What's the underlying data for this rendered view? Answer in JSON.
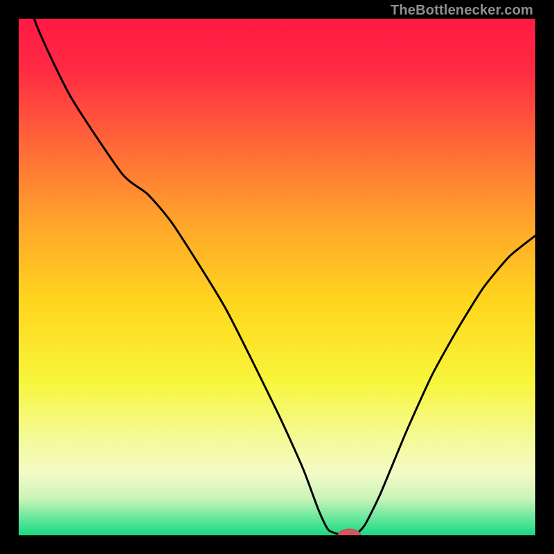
{
  "attribution": "TheBottlenecker.com",
  "colors": {
    "frame": "#000000",
    "curve": "#000000",
    "marker_fill": "#d7565e",
    "marker_stroke": "#b84a52"
  },
  "chart_data": {
    "type": "line",
    "title": "",
    "xlabel": "",
    "ylabel": "",
    "xlim": [
      0,
      100
    ],
    "ylim": [
      0,
      100
    ],
    "x": [
      0,
      3,
      10,
      20,
      25,
      30,
      40,
      50,
      55,
      58,
      60,
      63,
      65,
      67,
      70,
      75,
      80,
      85,
      90,
      95,
      100
    ],
    "values": [
      115,
      100,
      85,
      70,
      66,
      60,
      44,
      24,
      13,
      5,
      1,
      0,
      0,
      2,
      8,
      20,
      31,
      40,
      48,
      54,
      58
    ],
    "marker": {
      "x": 64,
      "y": 0,
      "rx": 2.2,
      "ry": 1.2
    },
    "gradient_stops": [
      {
        "offset": 0.0,
        "color": "#ff1944"
      },
      {
        "offset": 0.1,
        "color": "#ff2b42"
      },
      {
        "offset": 0.25,
        "color": "#ff6a38"
      },
      {
        "offset": 0.4,
        "color": "#ffa72a"
      },
      {
        "offset": 0.55,
        "color": "#ffd61e"
      },
      {
        "offset": 0.7,
        "color": "#f8f53a"
      },
      {
        "offset": 0.8,
        "color": "#f5fa8e"
      },
      {
        "offset": 0.88,
        "color": "#f3fbc8"
      },
      {
        "offset": 0.93,
        "color": "#c9f3b8"
      },
      {
        "offset": 0.965,
        "color": "#6be89e"
      },
      {
        "offset": 1.0,
        "color": "#18d980"
      }
    ]
  }
}
